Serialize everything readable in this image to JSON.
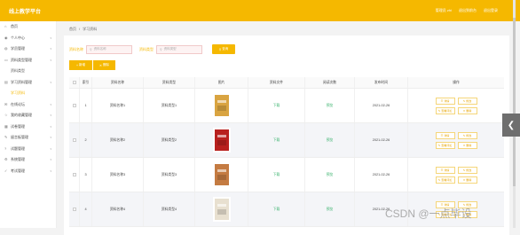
{
  "header": {
    "brand": "线上教学平台",
    "user": "管理员 zhi",
    "home_link": "退出到前台",
    "logout": "退出登录"
  },
  "sidebar": {
    "items": [
      {
        "label": "首页",
        "icon": "home-icon",
        "sub": false
      },
      {
        "label": "个人中心",
        "icon": "user-icon",
        "sub": false
      },
      {
        "label": "学员管理",
        "icon": "users-icon",
        "sub": false
      },
      {
        "label": "资料类型管理",
        "icon": "folder-icon",
        "sub": false
      },
      {
        "label": "资料类型",
        "icon": "",
        "sub": true
      },
      {
        "label": "学习资料管理",
        "icon": "book-icon",
        "sub": false
      },
      {
        "label": "学习资料",
        "icon": "",
        "sub": true,
        "active": true
      },
      {
        "label": "在线论坛",
        "icon": "forum-icon",
        "sub": false
      },
      {
        "label": "我的收藏管理",
        "icon": "star-icon",
        "sub": false
      },
      {
        "label": "试卷管理",
        "icon": "paper-icon",
        "sub": false
      },
      {
        "label": "留言板管理",
        "icon": "message-icon",
        "sub": false
      },
      {
        "label": "试题管理",
        "icon": "question-icon",
        "sub": false
      },
      {
        "label": "系统管理",
        "icon": "gear-icon",
        "sub": false
      },
      {
        "label": "考试管理",
        "icon": "exam-icon",
        "sub": false
      }
    ]
  },
  "breadcrumb": {
    "home": "首页",
    "sep": "/",
    "current": "学习资料"
  },
  "search": {
    "label1": "资料名称",
    "placeholder1": "资料名称",
    "label2": "资料类型",
    "placeholder2": "资料类型",
    "button": "查询"
  },
  "actions": {
    "add": "新增",
    "delete": "删除"
  },
  "table": {
    "headers": [
      "索引",
      "资料名称",
      "资料类型",
      "图片",
      "资料文件",
      "阅读次数",
      "发布时间",
      "操作"
    ],
    "rows": [
      {
        "idx": "1",
        "name": "资料名称1",
        "type": "资料类型1",
        "file": "下载",
        "read": "预览",
        "date": "2021-02-26",
        "cover": "#d9a441"
      },
      {
        "idx": "2",
        "name": "资料名称2",
        "type": "资料类型2",
        "file": "下载",
        "read": "预览",
        "date": "2021-02-26",
        "cover": "#b8201e"
      },
      {
        "idx": "3",
        "name": "资料名称3",
        "type": "资料类型3",
        "file": "下载",
        "read": "预览",
        "date": "2021-02-26",
        "cover": "#c47b42"
      },
      {
        "idx": "4",
        "name": "资料名称4",
        "type": "资料类型4",
        "file": "下载",
        "read": "预览",
        "date": "2021-02-26",
        "cover": "#e8e0d0"
      }
    ],
    "ops": [
      "详情",
      "修改",
      "查看评论",
      "删除"
    ]
  },
  "watermark": "CSDN @一点毕设",
  "colors": {
    "accent": "#f5b800",
    "link": "#3bb36e"
  }
}
